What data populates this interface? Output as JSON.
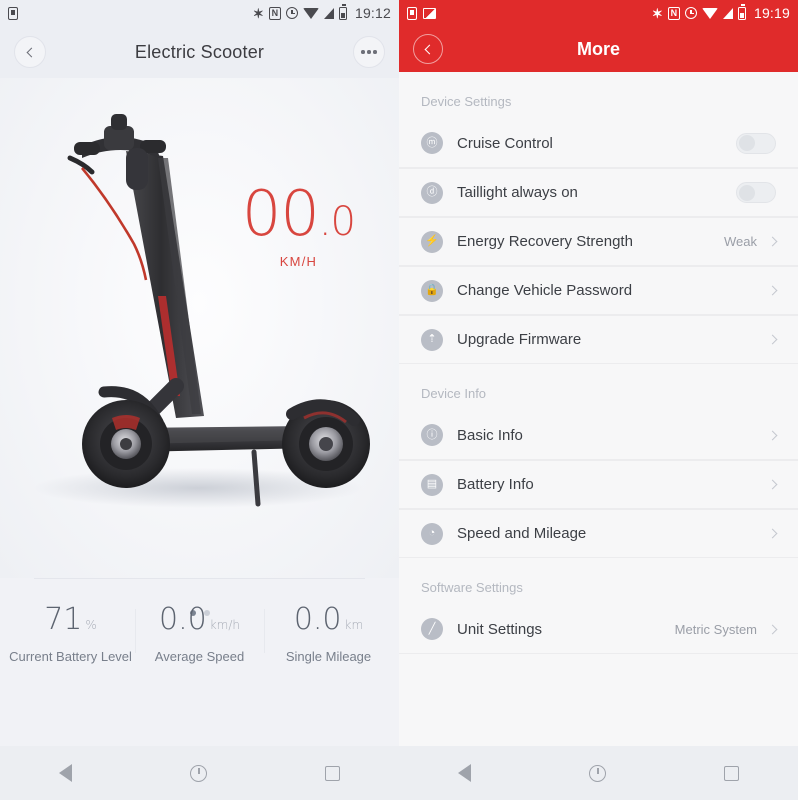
{
  "left": {
    "statusbar": {
      "time": "19:12",
      "icons": [
        "simcard-icon",
        "bluetooth-icon",
        "nfc-icon",
        "alarm-icon",
        "wifi-icon",
        "signal-icon",
        "battery-icon"
      ],
      "bluetooth_glyph": "✶",
      "nfc_glyph": "N"
    },
    "header": {
      "title": "Electric Scooter",
      "back_icon": "back-chevron-icon",
      "more_icon": "more-options-icon"
    },
    "speed": {
      "integer": "00",
      "decimal": ".0",
      "unit": "KM/H",
      "color": "#d8463f"
    },
    "carousel": {
      "dots": 2,
      "active": 0
    },
    "stats": [
      {
        "value": "71",
        "unit": "%",
        "label": "Current Battery Level"
      },
      {
        "value": "0.0",
        "unit": "km/h",
        "label": "Average Speed"
      },
      {
        "value": "0.0",
        "unit": "km",
        "label": "Single Mileage"
      }
    ]
  },
  "right": {
    "statusbar": {
      "time": "19:19"
    },
    "header": {
      "title": "More",
      "back_icon": "back-chevron-icon",
      "color": "#e02b2b"
    },
    "sections": [
      {
        "title": "Device Settings",
        "items": [
          {
            "label": "Cruise Control",
            "icon": "speedometer-icon",
            "glyph": "ⓜ",
            "control": "toggle",
            "on": false
          },
          {
            "label": "Taillight always on",
            "icon": "taillight-icon",
            "glyph": "ⓓ",
            "control": "toggle",
            "on": false
          },
          {
            "label": "Energy Recovery Strength",
            "icon": "bolt-icon",
            "glyph": "⚡",
            "control": "value",
            "value": "Weak"
          },
          {
            "label": "Change Vehicle Password",
            "icon": "lock-icon",
            "glyph": "ὑ2",
            "control": "chevron"
          },
          {
            "label": "Upgrade Firmware",
            "icon": "upgrade-icon",
            "glyph": "⇡",
            "control": "chevron"
          }
        ]
      },
      {
        "title": "Device Info",
        "items": [
          {
            "label": "Basic Info",
            "icon": "info-icon",
            "glyph": "ⓘ",
            "control": "chevron"
          },
          {
            "label": "Battery Info",
            "icon": "battery-info-icon",
            "glyph": "▤",
            "control": "chevron"
          },
          {
            "label": "Speed and Mileage",
            "icon": "gauge-icon",
            "glyph": "◔",
            "control": "chevron"
          }
        ]
      },
      {
        "title": "Software Settings",
        "items": [
          {
            "label": "Unit Settings",
            "icon": "ruler-icon",
            "glyph": "╱",
            "control": "value",
            "value": "Metric System"
          }
        ]
      }
    ]
  },
  "navbar": {
    "back": "nav-back-icon",
    "home": "nav-home-icon",
    "recents": "nav-recents-icon"
  }
}
